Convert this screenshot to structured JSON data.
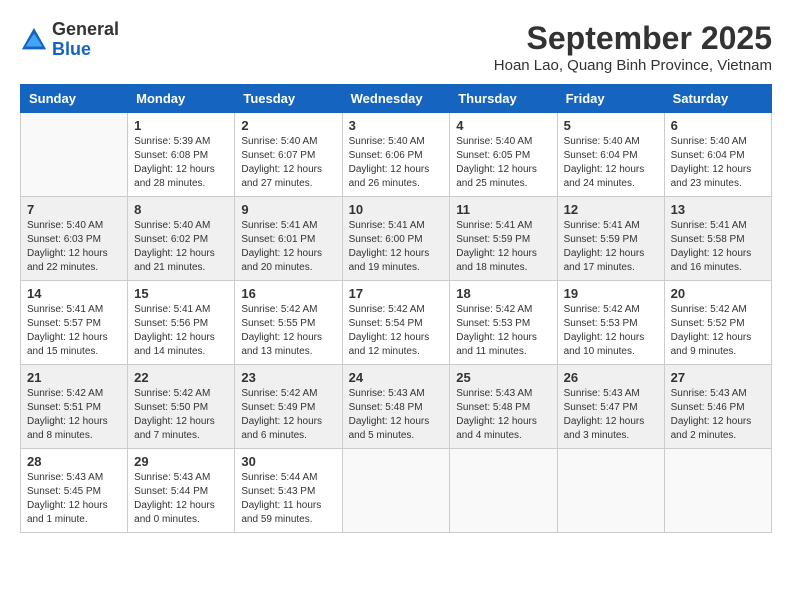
{
  "header": {
    "logo_general": "General",
    "logo_blue": "Blue",
    "month_title": "September 2025",
    "subtitle": "Hoan Lao, Quang Binh Province, Vietnam"
  },
  "weekdays": [
    "Sunday",
    "Monday",
    "Tuesday",
    "Wednesday",
    "Thursday",
    "Friday",
    "Saturday"
  ],
  "weeks": [
    [
      {
        "day": "",
        "sunrise": "",
        "sunset": "",
        "daylight": ""
      },
      {
        "day": "1",
        "sunrise": "Sunrise: 5:39 AM",
        "sunset": "Sunset: 6:08 PM",
        "daylight": "Daylight: 12 hours and 28 minutes."
      },
      {
        "day": "2",
        "sunrise": "Sunrise: 5:40 AM",
        "sunset": "Sunset: 6:07 PM",
        "daylight": "Daylight: 12 hours and 27 minutes."
      },
      {
        "day": "3",
        "sunrise": "Sunrise: 5:40 AM",
        "sunset": "Sunset: 6:06 PM",
        "daylight": "Daylight: 12 hours and 26 minutes."
      },
      {
        "day": "4",
        "sunrise": "Sunrise: 5:40 AM",
        "sunset": "Sunset: 6:05 PM",
        "daylight": "Daylight: 12 hours and 25 minutes."
      },
      {
        "day": "5",
        "sunrise": "Sunrise: 5:40 AM",
        "sunset": "Sunset: 6:04 PM",
        "daylight": "Daylight: 12 hours and 24 minutes."
      },
      {
        "day": "6",
        "sunrise": "Sunrise: 5:40 AM",
        "sunset": "Sunset: 6:04 PM",
        "daylight": "Daylight: 12 hours and 23 minutes."
      }
    ],
    [
      {
        "day": "7",
        "sunrise": "Sunrise: 5:40 AM",
        "sunset": "Sunset: 6:03 PM",
        "daylight": "Daylight: 12 hours and 22 minutes."
      },
      {
        "day": "8",
        "sunrise": "Sunrise: 5:40 AM",
        "sunset": "Sunset: 6:02 PM",
        "daylight": "Daylight: 12 hours and 21 minutes."
      },
      {
        "day": "9",
        "sunrise": "Sunrise: 5:41 AM",
        "sunset": "Sunset: 6:01 PM",
        "daylight": "Daylight: 12 hours and 20 minutes."
      },
      {
        "day": "10",
        "sunrise": "Sunrise: 5:41 AM",
        "sunset": "Sunset: 6:00 PM",
        "daylight": "Daylight: 12 hours and 19 minutes."
      },
      {
        "day": "11",
        "sunrise": "Sunrise: 5:41 AM",
        "sunset": "Sunset: 5:59 PM",
        "daylight": "Daylight: 12 hours and 18 minutes."
      },
      {
        "day": "12",
        "sunrise": "Sunrise: 5:41 AM",
        "sunset": "Sunset: 5:59 PM",
        "daylight": "Daylight: 12 hours and 17 minutes."
      },
      {
        "day": "13",
        "sunrise": "Sunrise: 5:41 AM",
        "sunset": "Sunset: 5:58 PM",
        "daylight": "Daylight: 12 hours and 16 minutes."
      }
    ],
    [
      {
        "day": "14",
        "sunrise": "Sunrise: 5:41 AM",
        "sunset": "Sunset: 5:57 PM",
        "daylight": "Daylight: 12 hours and 15 minutes."
      },
      {
        "day": "15",
        "sunrise": "Sunrise: 5:41 AM",
        "sunset": "Sunset: 5:56 PM",
        "daylight": "Daylight: 12 hours and 14 minutes."
      },
      {
        "day": "16",
        "sunrise": "Sunrise: 5:42 AM",
        "sunset": "Sunset: 5:55 PM",
        "daylight": "Daylight: 12 hours and 13 minutes."
      },
      {
        "day": "17",
        "sunrise": "Sunrise: 5:42 AM",
        "sunset": "Sunset: 5:54 PM",
        "daylight": "Daylight: 12 hours and 12 minutes."
      },
      {
        "day": "18",
        "sunrise": "Sunrise: 5:42 AM",
        "sunset": "Sunset: 5:53 PM",
        "daylight": "Daylight: 12 hours and 11 minutes."
      },
      {
        "day": "19",
        "sunrise": "Sunrise: 5:42 AM",
        "sunset": "Sunset: 5:53 PM",
        "daylight": "Daylight: 12 hours and 10 minutes."
      },
      {
        "day": "20",
        "sunrise": "Sunrise: 5:42 AM",
        "sunset": "Sunset: 5:52 PM",
        "daylight": "Daylight: 12 hours and 9 minutes."
      }
    ],
    [
      {
        "day": "21",
        "sunrise": "Sunrise: 5:42 AM",
        "sunset": "Sunset: 5:51 PM",
        "daylight": "Daylight: 12 hours and 8 minutes."
      },
      {
        "day": "22",
        "sunrise": "Sunrise: 5:42 AM",
        "sunset": "Sunset: 5:50 PM",
        "daylight": "Daylight: 12 hours and 7 minutes."
      },
      {
        "day": "23",
        "sunrise": "Sunrise: 5:42 AM",
        "sunset": "Sunset: 5:49 PM",
        "daylight": "Daylight: 12 hours and 6 minutes."
      },
      {
        "day": "24",
        "sunrise": "Sunrise: 5:43 AM",
        "sunset": "Sunset: 5:48 PM",
        "daylight": "Daylight: 12 hours and 5 minutes."
      },
      {
        "day": "25",
        "sunrise": "Sunrise: 5:43 AM",
        "sunset": "Sunset: 5:48 PM",
        "daylight": "Daylight: 12 hours and 4 minutes."
      },
      {
        "day": "26",
        "sunrise": "Sunrise: 5:43 AM",
        "sunset": "Sunset: 5:47 PM",
        "daylight": "Daylight: 12 hours and 3 minutes."
      },
      {
        "day": "27",
        "sunrise": "Sunrise: 5:43 AM",
        "sunset": "Sunset: 5:46 PM",
        "daylight": "Daylight: 12 hours and 2 minutes."
      }
    ],
    [
      {
        "day": "28",
        "sunrise": "Sunrise: 5:43 AM",
        "sunset": "Sunset: 5:45 PM",
        "daylight": "Daylight: 12 hours and 1 minute."
      },
      {
        "day": "29",
        "sunrise": "Sunrise: 5:43 AM",
        "sunset": "Sunset: 5:44 PM",
        "daylight": "Daylight: 12 hours and 0 minutes."
      },
      {
        "day": "30",
        "sunrise": "Sunrise: 5:44 AM",
        "sunset": "Sunset: 5:43 PM",
        "daylight": "Daylight: 11 hours and 59 minutes."
      },
      {
        "day": "",
        "sunrise": "",
        "sunset": "",
        "daylight": ""
      },
      {
        "day": "",
        "sunrise": "",
        "sunset": "",
        "daylight": ""
      },
      {
        "day": "",
        "sunrise": "",
        "sunset": "",
        "daylight": ""
      },
      {
        "day": "",
        "sunrise": "",
        "sunset": "",
        "daylight": ""
      }
    ]
  ]
}
